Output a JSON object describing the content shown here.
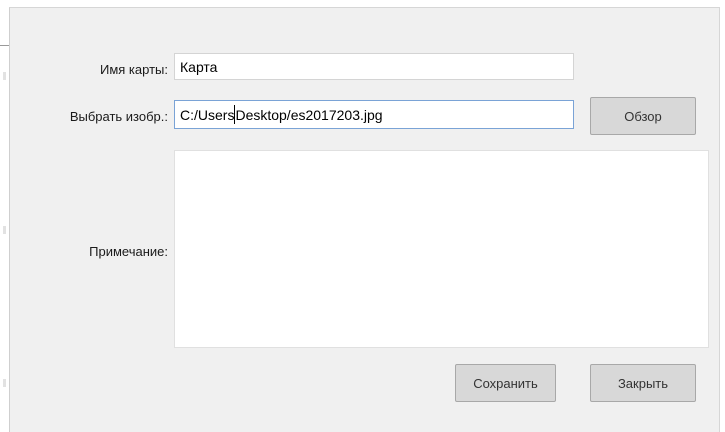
{
  "dialog": {
    "map_name_label": "Имя карты:",
    "map_name_value": "Карта",
    "image_label": "Выбрать изобр.:",
    "image_path_before_caret": "C:/Users",
    "image_path_after_caret": "Desktop/es2017203.jpg",
    "browse_button": "Обзор",
    "note_label": "Примечание:",
    "note_value": "",
    "save_button": "Сохранить",
    "close_button": "Закрыть"
  }
}
